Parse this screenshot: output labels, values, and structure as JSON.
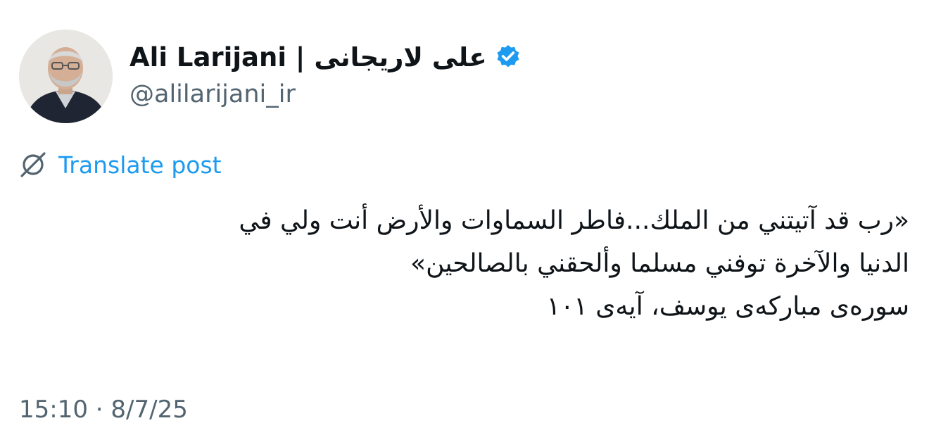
{
  "author": {
    "display_name": "Ali Larijani | علی لاریجانی",
    "handle": "@alilarijani_ir",
    "verified": true,
    "verified_badge_color": "#1d9bf0"
  },
  "translate": {
    "label": "Translate post",
    "icon": "translate-icon"
  },
  "post": {
    "lines": [
      "«رب قد آتيتني من الملك...فاطر السماوات والأرض أنت ولي في",
      "الدنيا والآخرة توفني مسلما وألحقني بالصالحين»",
      "سوره‌ی مبارکه‌ی یوسف، آیه‌ی ۱۰۱"
    ]
  },
  "meta": {
    "timestamp": "15:10 · 8/7/25"
  },
  "colors": {
    "text": "#0f1419",
    "secondary": "#536471",
    "link": "#1d9bf0"
  }
}
